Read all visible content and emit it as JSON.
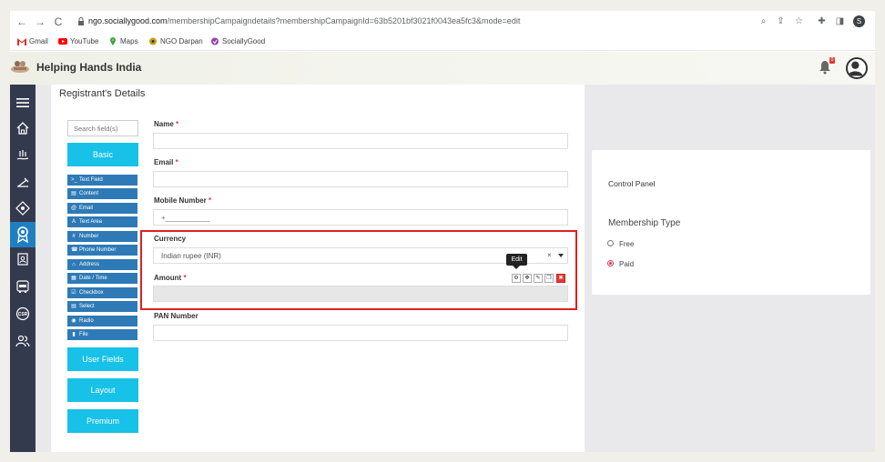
{
  "browser": {
    "url_host": "ngo.sociallygood.com",
    "url_path": "/membershipCampaigndetails?membershipCampaignId=63b5201bf3021f0043ea5fc3&mode=edit",
    "profile_initial": "S",
    "bookmarks": [
      {
        "label": "Gmail"
      },
      {
        "label": "YouTube"
      },
      {
        "label": "Maps"
      },
      {
        "label": "NGO Darpan"
      },
      {
        "label": "SociallyGood"
      }
    ]
  },
  "header": {
    "app_title": "Helping Hands India",
    "notification_count": "0"
  },
  "form": {
    "heading": "Registrant's Details",
    "search_placeholder": "Search field(s)",
    "categories": {
      "basic": "Basic",
      "user_fields": "User Fields",
      "layout": "Layout",
      "premium": "Premium"
    },
    "field_types": [
      {
        "icon": ">_",
        "label": "Text Field"
      },
      {
        "icon": "▤",
        "label": "Content"
      },
      {
        "icon": "@",
        "label": "Email"
      },
      {
        "icon": "A",
        "label": "Text Area"
      },
      {
        "icon": "#",
        "label": "Number"
      },
      {
        "icon": "☎",
        "label": "Phone Number"
      },
      {
        "icon": "⌂",
        "label": "Address"
      },
      {
        "icon": "▦",
        "label": "Date / Time"
      },
      {
        "icon": "☑",
        "label": "Checkbox"
      },
      {
        "icon": "▤",
        "label": "Select"
      },
      {
        "icon": "◉",
        "label": "Radio"
      },
      {
        "icon": "▮",
        "label": "File"
      }
    ],
    "fields": {
      "name_label": "Name",
      "email_label": "Email",
      "mobile_label": "Mobile Number",
      "mobile_placeholder": "+___________",
      "currency_label": "Currency",
      "currency_value": "Indian rupee (INR)",
      "amount_label": "Amount",
      "pan_label": "PAN Number",
      "required_mark": "*",
      "clear_glyph": "×"
    },
    "edit_tooltip": "Edit"
  },
  "control_panel": {
    "title": "Control Panel",
    "membership_type_label": "Membership Type",
    "options": [
      {
        "label": "Free",
        "selected": false
      },
      {
        "label": "Paid",
        "selected": true
      }
    ]
  }
}
